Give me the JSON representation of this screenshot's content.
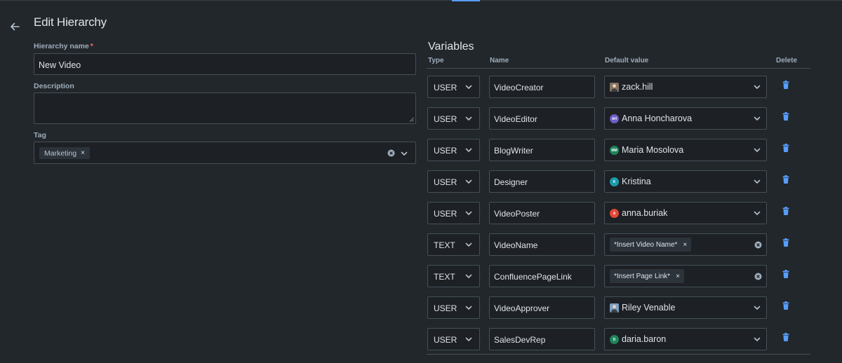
{
  "page": {
    "title": "Edit Hierarchy"
  },
  "form": {
    "hierarchy_name": {
      "label": "Hierarchy name",
      "required_mark": "*",
      "value": "New Video"
    },
    "description": {
      "label": "Description",
      "value": ""
    },
    "tag": {
      "label": "Tag",
      "chips": [
        "Marketing"
      ],
      "chip_remove": "×"
    }
  },
  "variables": {
    "title": "Variables",
    "columns": {
      "type": "Type",
      "name": "Name",
      "default_value": "Default value",
      "delete": "Delete"
    },
    "rows": [
      {
        "type": "USER",
        "name": "VideoCreator",
        "default": "zack.hill",
        "avatar": {
          "kind": "photo",
          "color": "#8a7563"
        }
      },
      {
        "type": "USER",
        "name": "VideoEditor",
        "default": "Anna Honcharova",
        "avatar": {
          "kind": "initials",
          "initials": "AH",
          "color": "#6e5dc6"
        }
      },
      {
        "type": "USER",
        "name": "BlogWriter",
        "default": "Maria Mosolova",
        "avatar": {
          "kind": "initials",
          "initials": "MM",
          "color": "#1f845a"
        }
      },
      {
        "type": "USER",
        "name": "Designer",
        "default": "Kristina",
        "avatar": {
          "kind": "initials",
          "initials": "K",
          "color": "#1d9aaa"
        }
      },
      {
        "type": "USER",
        "name": "VideoPoster",
        "default": "anna.buriak",
        "avatar": {
          "kind": "initials",
          "initials": "A",
          "color": "#e34935"
        }
      },
      {
        "type": "TEXT",
        "name": "VideoName",
        "default": "*Insert Video Name*"
      },
      {
        "type": "TEXT",
        "name": "ConfluencePageLink",
        "default": "*Insert Page Link*"
      },
      {
        "type": "USER",
        "name": "VideoApprover",
        "default": "Riley Venable",
        "avatar": {
          "kind": "photo",
          "color": "#7f9fc4"
        }
      },
      {
        "type": "USER",
        "name": "SalesDevRep",
        "default": "daria.baron",
        "avatar": {
          "kind": "initials",
          "initials": "D",
          "color": "#1f845a"
        }
      }
    ]
  },
  "icons": {
    "back": "arrow-left-icon",
    "chevron": "chevron-down-icon",
    "clear": "clear-icon",
    "remove": "close-icon",
    "trash": "trash-icon"
  },
  "colors": {
    "accent": "#579dff",
    "required": "#f87168",
    "trash": "#579dff",
    "background": "#22272b"
  }
}
